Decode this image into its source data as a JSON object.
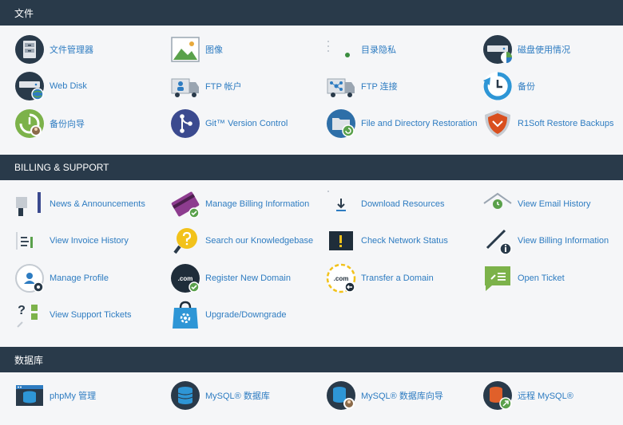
{
  "colors": {
    "header_bg": "#293a4a",
    "link": "#2e7cc1",
    "body_bg": "#f5f6f8"
  },
  "sections": {
    "files": {
      "title": "文件",
      "items": [
        {
          "label": "文件管理器",
          "icon": "file-cabinet-icon"
        },
        {
          "label": "图像",
          "icon": "image-icon"
        },
        {
          "label": "目录隐私",
          "icon": "directory-privacy-icon"
        },
        {
          "label": "磁盘使用情况",
          "icon": "disk-usage-icon"
        },
        {
          "label": "Web Disk",
          "icon": "web-disk-icon"
        },
        {
          "label": "FTP 帐户",
          "icon": "ftp-account-icon"
        },
        {
          "label": "FTP 连接",
          "icon": "ftp-connections-icon"
        },
        {
          "label": "备份",
          "icon": "backup-icon"
        },
        {
          "label": "备份向导",
          "icon": "backup-wizard-icon"
        },
        {
          "label": "Git™ Version Control",
          "icon": "git-icon"
        },
        {
          "label": "File and Directory Restoration",
          "icon": "file-restore-icon"
        },
        {
          "label": "R1Soft Restore Backups",
          "icon": "r1soft-shield-icon"
        }
      ]
    },
    "billing": {
      "title": "BILLING & SUPPORT",
      "items": [
        {
          "label": "News & Announcements",
          "icon": "megaphone-icon"
        },
        {
          "label": "Manage Billing Information",
          "icon": "credit-card-icon"
        },
        {
          "label": "Download Resources",
          "icon": "download-icon"
        },
        {
          "label": "View Email History",
          "icon": "email-history-icon"
        },
        {
          "label": "View Invoice History",
          "icon": "invoice-icon"
        },
        {
          "label": "Search our Knowledgebase",
          "icon": "knowledgebase-icon"
        },
        {
          "label": "Check Network Status",
          "icon": "network-status-icon"
        },
        {
          "label": "View Billing Information",
          "icon": "billing-info-icon"
        },
        {
          "label": "Manage Profile",
          "icon": "profile-icon"
        },
        {
          "label": "Register New Domain",
          "icon": "register-domain-icon",
          "badge": ".com"
        },
        {
          "label": "Transfer a Domain",
          "icon": "transfer-domain-icon",
          "badge": ".com"
        },
        {
          "label": "Open Ticket",
          "icon": "open-ticket-icon"
        },
        {
          "label": "View Support Tickets",
          "icon": "support-tickets-icon"
        },
        {
          "label": "Upgrade/Downgrade",
          "icon": "upgrade-bag-icon"
        }
      ]
    },
    "databases": {
      "title": "数据库",
      "items": [
        {
          "label": "phpMy 管理",
          "icon": "phpmyadmin-icon"
        },
        {
          "label": "MySQL® 数据库",
          "icon": "mysql-database-icon"
        },
        {
          "label": "MySQL® 数据库向导",
          "icon": "mysql-wizard-icon"
        },
        {
          "label": "远程 MySQL®",
          "icon": "remote-mysql-icon"
        }
      ]
    }
  }
}
